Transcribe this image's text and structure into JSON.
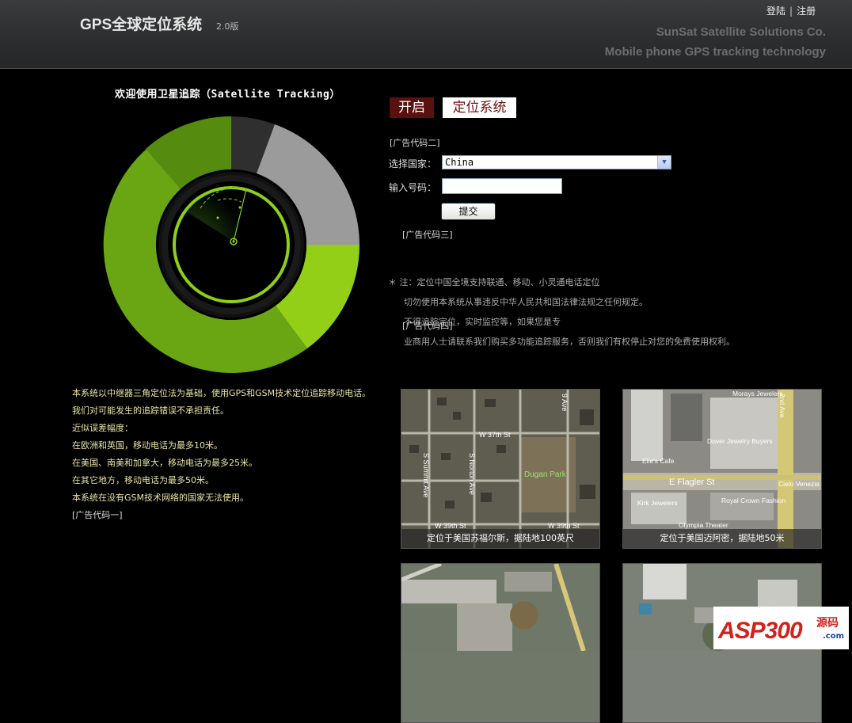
{
  "header": {
    "title": "GPS全球定位系统",
    "version": "2.0版",
    "login": "登陆",
    "separator": "|",
    "register": "注册",
    "company": "SunSat Satellite Solutions Co.",
    "tagline": "Mobile phone GPS tracking technology"
  },
  "welcome": "欢迎使用卫星追踪（Satellite Tracking）",
  "info": {
    "lines": [
      "本系统以中继器三角定位法为基础，使用GPS和GSM技术定位追踪移动电话。",
      "我们对可能发生的追踪错误不承担责任。",
      "近似误差幅度：",
      "在欧洲和英国，移动电话为最多10米。",
      "在美国、南美和加拿大，移动电话为最多25米。",
      "在其它地方，移动电话为最多50米。",
      "本系统在没有GSM技术网络的国家无法使用。"
    ],
    "ad": "[广告代码一]"
  },
  "form": {
    "open_label": "开启",
    "system_label": "定位系统",
    "ad2": "[广告代码二]",
    "country_label": "选择国家：",
    "country_value": "China",
    "number_label": "输入号码：",
    "number_value": "",
    "submit_label": "提交",
    "ad3": "[广告代码三]"
  },
  "notes": {
    "line1": "＊ 注：定位中国全境支持联通、移动、小灵通电话定位",
    "line2": "切勿使用本系统从事违反中华人民共和国法律法规之任何规定。",
    "line3": "不得追踪定位，实时监控等，如果您是专",
    "line4": "业商用人士请联系我们购买多功能追踪服务，否则我们有权停止对您的免费使用权利。",
    "ad4": "[广告代码四]"
  },
  "maps": [
    {
      "caption": "定位于美国苏福尔斯，据陆地100英尺",
      "labels": [
        "W 37th St",
        "Dugan Park",
        "S Summit Ave",
        "S Norton Ave",
        "W 39th St",
        "W 39th St",
        "9 Ave"
      ]
    },
    {
      "caption": "定位于美国迈阿密，据陆地50米",
      "labels": [
        "Morays Jewelers",
        "Dover Jewelry Buyers",
        "Elie's Cafe",
        "E Flagler St",
        "Kirk Jewelers",
        "Royal Crown Fashion",
        "Olympia Theater",
        "Cielo Venezia",
        "2nd Ave"
      ]
    },
    {
      "caption": ""
    },
    {
      "caption": ""
    }
  ],
  "radar": {
    "colors": {
      "bright_green": "#8fcf15",
      "dark_green": "#5a8f12",
      "gray": "#9a9a9a",
      "dark_gray": "#333333"
    },
    "segments_percent": {
      "dark_green": 13,
      "dark_gray": 5,
      "gray": 26,
      "bright_green": 56
    }
  },
  "watermark": {
    "text": "ASP300",
    "sub": "源码",
    "com": ".com"
  }
}
